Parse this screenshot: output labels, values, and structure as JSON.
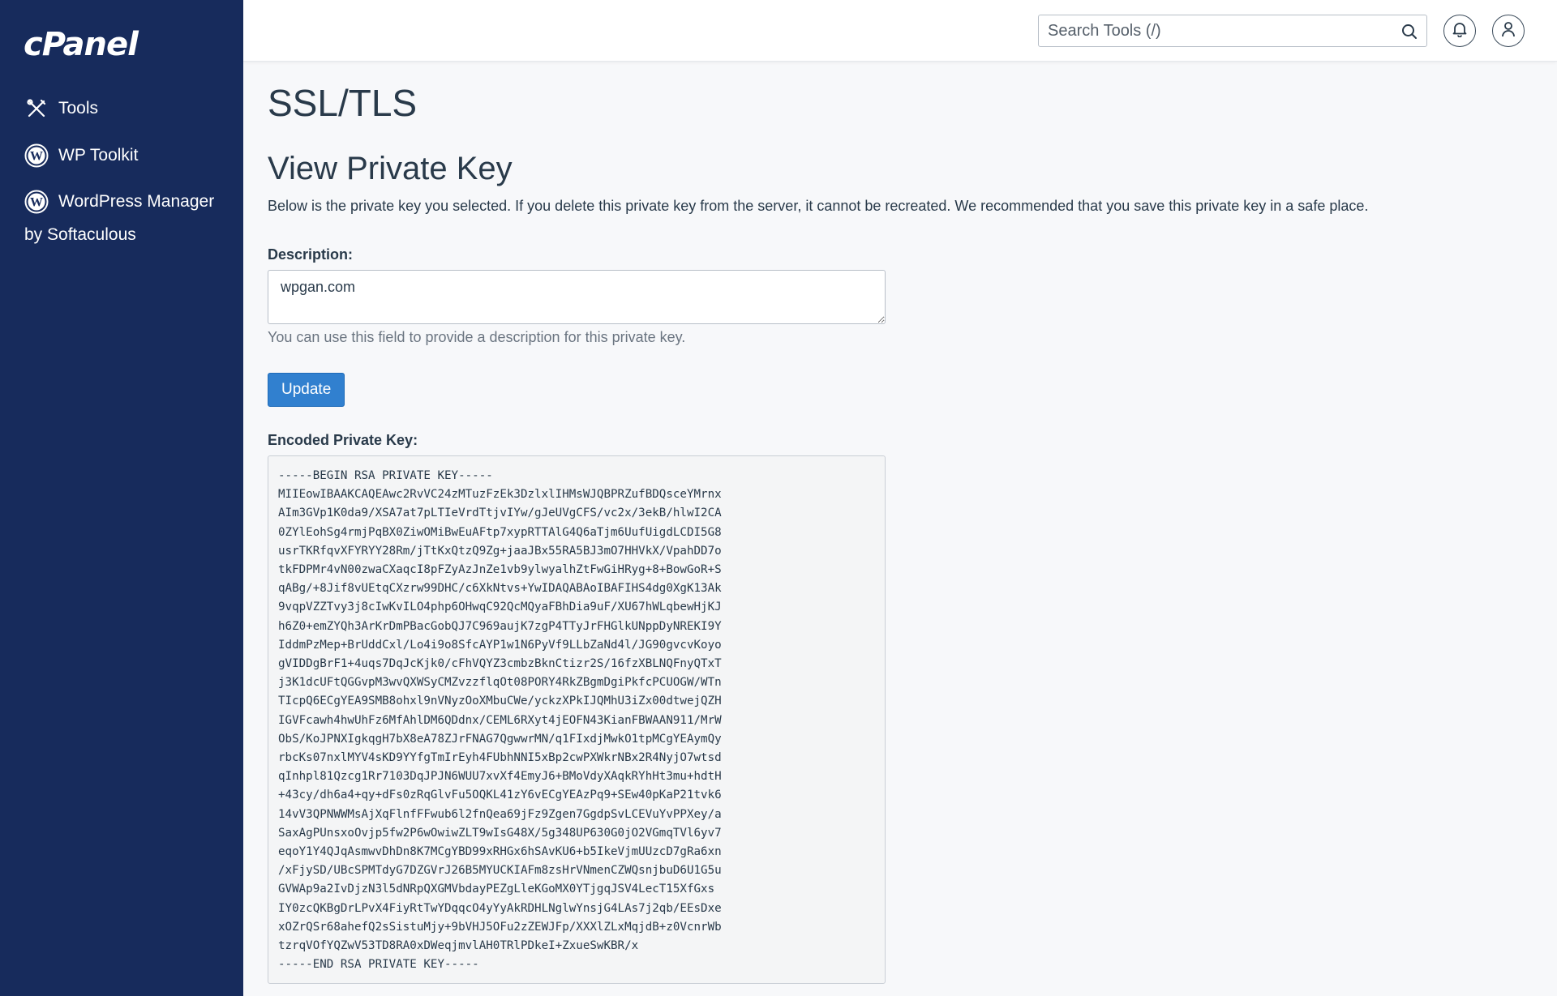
{
  "sidebar": {
    "logo": "cPanel",
    "items": [
      {
        "label": "Tools",
        "icon": "tools-icon"
      },
      {
        "label": "WP Toolkit",
        "icon": "wordpress-icon"
      },
      {
        "label": "WordPress Manager",
        "label2": "by Softaculous",
        "icon": "wordpress-icon"
      }
    ]
  },
  "header": {
    "search_placeholder": "Search Tools (/)",
    "icons": [
      "search-icon",
      "bell-icon",
      "user-icon"
    ]
  },
  "main": {
    "page_title": "SSL/TLS",
    "section_title": "View Private Key",
    "intro": "Below is the private key you selected. If you delete this private key from the server, it cannot be recreated. We recommended that you save this private key in a safe place.",
    "description_label": "Description:",
    "description_value": "wpgan.com",
    "description_help": "You can use this field to provide a description for this private key.",
    "update_label": "Update",
    "key_label": "Encoded Private Key:",
    "key_lines": [
      "-----BEGIN RSA PRIVATE KEY-----",
      "MIIEowIBAAKCAQEAwc2RvVC24zMTuzFzEk3DzlxlIHMsWJQBPRZufBDQsceYMrnx",
      "AIm3GVp1K0da9/XSA7at7pLTIeVrdTtjvIYw/gJeUVgCFS/vc2x/3ekB/hlwI2CA",
      "0ZYlEohSg4rmjPqBX0ZiwOMiBwEuAFtp7xypRTTAlG4Q6aTjm6UufUigdLCDI5G8",
      "usrTKRfqvXFYRYY28Rm/jTtKxQtzQ9Zg+jaaJBx55RA5BJ3mO7HHVkX/VpahDD7o",
      "tkFDPMr4vN00zwaCXaqcI8pFZyAzJnZe1vb9ylwyalhZtFwGiHRyg+8+BowGoR+S",
      "qABg/+8Jif8vUEtqCXzrw99DHC/c6XkNtvs+YwIDAQABAoIBAFIHS4dg0XgK13Ak",
      "9vqpVZZTvy3j8cIwKvILO4php6OHwqC92QcMQyaFBhDia9uF/XU67hWLqbewHjKJ",
      "h6Z0+emZYQh3ArKrDmPBacGobQJ7C969aujK7zgP4TTyJrFHGlkUNppDyNREKI9Y",
      "IddmPzMep+BrUddCxl/Lo4i9o8SfcAYP1w1N6PyVf9LLbZaNd4l/JG90gvcvKoyo",
      "gVIDDgBrF1+4uqs7DqJcKjk0/cFhVQYZ3cmbzBknCtizr2S/16fzXBLNQFnyQTxT",
      "j3K1dcUFtQGGvpM3wvQXWSyCMZvzzflqOt08PORY4RkZBgmDgiPkfcPCUOGW/WTn",
      "TIcpQ6ECgYEA9SMB8ohxl9nVNyzOoXMbuCWe/yckzXPkIJQMhU3iZx00dtwejQZH",
      "IGVFcawh4hwUhFz6MfAhlDM6QDdnx/CEML6RXyt4jEOFN43KianFBWAAN911/MrW",
      "ObS/KoJPNXIgkqgH7bX8eA78ZJrFNAG7QgwwrMN/q1FIxdjMwkO1tpMCgYEAymQy",
      "rbcKs07nxlMYV4sKD9YYfgTmIrEyh4FUbhNNI5xBp2cwPXWkrNBx2R4NyjO7wtsd",
      "qInhpl81Qzcg1Rr7103DqJPJN6WUU7xvXf4EmyJ6+BMoVdyXAqkRYhHt3mu+hdtH",
      "+43cy/dh6a4+qy+dFs0zRqGlvFu5OQKL41zY6vECgYEAzPq9+SEw40pKaP21tvk6",
      "14vV3QPNWWMsAjXqFlnfFFwub6l2fnQea69jFz9Zgen7GgdpSvLCEVuYvPPXey/a",
      "SaxAgPUnsxoOvjp5fw2P6wOwiwZLT9wIsG48X/5g348UP630G0jO2VGmqTVl6yv7",
      "eqoY1Y4QJqAsmwvDhDn8K7MCgYBD99xRHGx6hSAvKU6+b5IkeVjmUUzcD7gRa6xn",
      "/xFjySD/UBcSPMTdyG7DZGVrJ26B5MYUCKIAFm8zsHrVNmenCZWQsnjbuD6U1G5u",
      "GVWAp9a2IvDjzN3l5dNRpQXGMVbdayPEZgLleKGoMX0YTjgqJSV4LecT15XfGxs",
      "IY0zcQKBgDrLPvX4FiyRtTwYDqqcO4yYyAkRDHLNglwYnsjG4LAs7j2qb/EEsDxe",
      "xOZrQSr68ahefQ2sSistuMjy+9bVHJ5OFu2zZEWJFp/XXXlZLxMqjdB+z0VcnrWb",
      "tzrqVOfYQZwV53TD8RA0xDWeqjmvlAH0TRlPDkeI+ZxueSwKBR/x",
      "-----END RSA PRIVATE KEY-----"
    ]
  }
}
